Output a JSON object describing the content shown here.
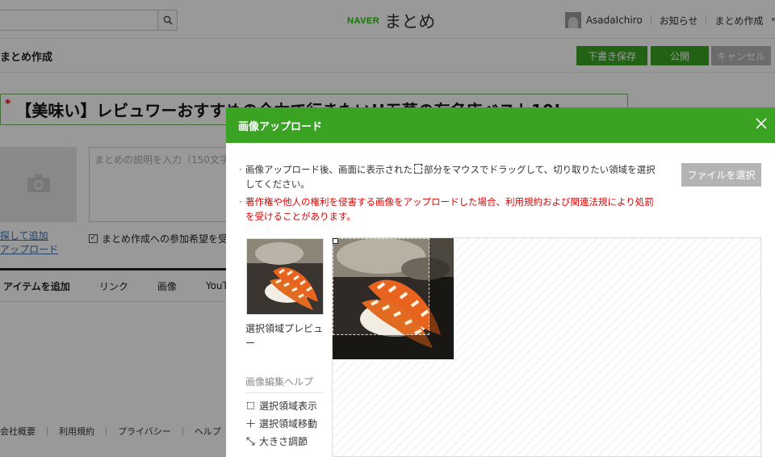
{
  "header": {
    "search": {
      "value": "",
      "placeholder": ""
    },
    "logo": {
      "naver": "NAVER",
      "matome": "まとめ"
    },
    "user": {
      "name": "AsadaIchiro",
      "links": [
        "お知らせ",
        "まとめ作成"
      ]
    }
  },
  "toolbar": {
    "page_title": "まとめ作成",
    "save_draft_label": "下書き保存",
    "publish_label": "公開",
    "cancel_label": "キャンセル"
  },
  "editor": {
    "required_mark": "*",
    "title_value": "【美味い】レビュワーおすすめの全力で行きたい!!五草の有名店ベスト10!",
    "description_placeholder": "まとめの説明を入力（150文字",
    "search_add_link": "探して追加",
    "upload_link": "アップロード",
    "collab_label": "まとめ作成への参加希望を受",
    "collab_checked": true,
    "tabs": [
      "アイテムを追加",
      "リンク",
      "画像",
      "YouTube"
    ]
  },
  "footer": {
    "links": [
      "会社概要",
      "利用規約",
      "プライバシー",
      "ヘルプ"
    ]
  },
  "modal": {
    "title": "画像アップロード",
    "note_1a": "画像アップロード後、画面に表示された",
    "note_1b": "部分をマウスでドラッグして、切り取りたい領域を選択してください。",
    "note_2": "著作権や他人の権利を侵害する画像をアップロードした場合、利用規約および関連法規により処罰を受けることがあります。",
    "file_button": "ファイルを選択",
    "preview_label": "選択領域プレビュー",
    "help_title": "画像編集ヘルプ",
    "help_items": [
      "選択領域表示",
      "選択領域移動",
      "大きさ調節"
    ]
  },
  "colors": {
    "accent": "#3aa324",
    "naver_green": "#1ec800",
    "warning": "#e00000",
    "disabled": "#b4b4b4"
  },
  "icons": {
    "search": "search-icon",
    "camera": "camera-icon",
    "close": "close-icon",
    "select_area": "select-area-icon",
    "move": "move-icon",
    "resize": "resize-icon"
  }
}
